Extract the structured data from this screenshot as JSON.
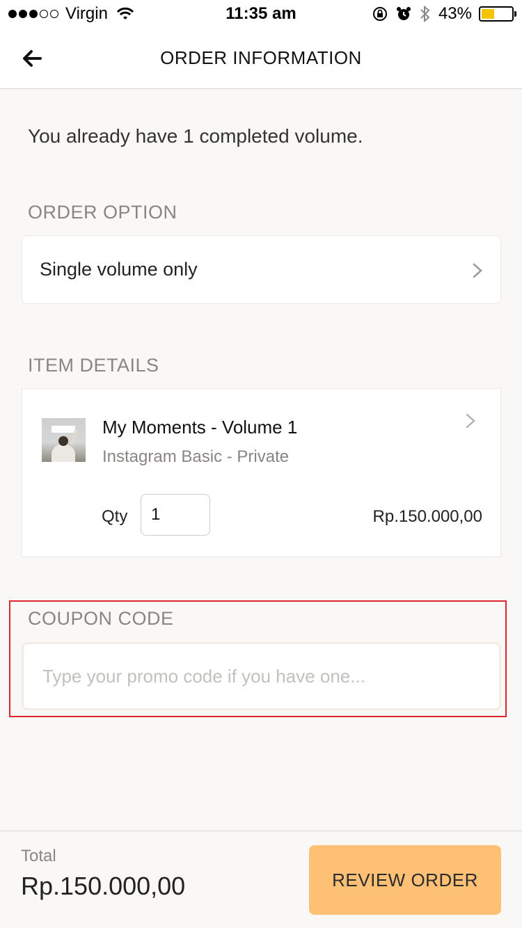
{
  "status_bar": {
    "signal_dots_filled": 3,
    "signal_dots_total": 5,
    "carrier": "Virgin",
    "time": "11:35 am",
    "battery_percent": "43%",
    "battery_level": 0.43,
    "icons": [
      "wifi-icon",
      "orientation-lock-icon",
      "alarm-icon",
      "bluetooth-icon",
      "battery-icon"
    ]
  },
  "nav": {
    "title": "ORDER INFORMATION",
    "back_icon": "arrow-left-icon"
  },
  "info_text": "You already have 1 completed volume.",
  "order_option": {
    "label": "ORDER OPTION",
    "value": "Single volume only"
  },
  "item_details": {
    "label": "ITEM DETAILS",
    "title": "My Moments - Volume 1",
    "subtitle": "Instagram Basic - Private",
    "qty_label": "Qty",
    "qty_value": "1",
    "price": "Rp.150.000,00"
  },
  "coupon": {
    "label": "COUPON CODE",
    "placeholder": "Type your promo code if you have one...",
    "value": ""
  },
  "footer": {
    "total_label": "Total",
    "total_value": "Rp.150.000,00",
    "review_button": "REVIEW ORDER"
  },
  "colors": {
    "background": "#faf8f6",
    "accent_button": "#fdc074",
    "highlight_border": "#d9262d",
    "muted_text": "#8a8582",
    "battery": "#f5c400"
  }
}
